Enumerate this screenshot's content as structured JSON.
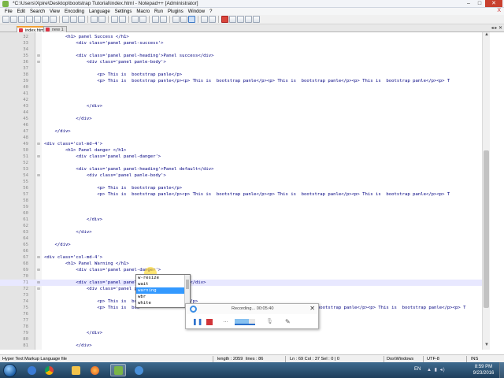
{
  "window": {
    "title": "*C:\\Users\\Xpire\\Desktop\\bootstrap Tutorial\\index.html - Notepad++ [Administrator]",
    "minimize": "–",
    "maximize": "□",
    "close": "✕"
  },
  "menu": [
    "File",
    "Edit",
    "Search",
    "View",
    "Encoding",
    "Language",
    "Settings",
    "Macro",
    "Run",
    "Plugins",
    "Window",
    "?"
  ],
  "menu_close": "X",
  "tabs": [
    {
      "label": "index.html"
    },
    {
      "label": "new 1"
    }
  ],
  "tab_arrows": "◂ ▸ ✕",
  "lines": [
    {
      "n": "32",
      "fold": "",
      "code": "        <h1> panel Success </h1>"
    },
    {
      "n": "33",
      "fold": "",
      "code": "            <div class='panel panel-success'>"
    },
    {
      "n": "34",
      "fold": "",
      "code": ""
    },
    {
      "n": "35",
      "fold": "⊟",
      "code": "            <div class='panel panel-heading'>Panel success</div>"
    },
    {
      "n": "36",
      "fold": "⊟",
      "code": "                <div class='panel panle-body'>"
    },
    {
      "n": "37",
      "fold": "",
      "code": ""
    },
    {
      "n": "38",
      "fold": "",
      "code": "                    <p> This is  bootstrap panle</p>"
    },
    {
      "n": "39",
      "fold": "",
      "code": "                    <p> This is  bootstrap panle</p><p> This is  bootstrap panle</p><p> This is  bootstrap panle</p><p> This is  bootstrap panle</p><p> T"
    },
    {
      "n": "40",
      "fold": "",
      "code": ""
    },
    {
      "n": "41",
      "fold": "",
      "code": ""
    },
    {
      "n": "42",
      "fold": "",
      "code": ""
    },
    {
      "n": "43",
      "fold": "",
      "code": "                </div>"
    },
    {
      "n": "44",
      "fold": "",
      "code": ""
    },
    {
      "n": "45",
      "fold": "",
      "code": "            </div>"
    },
    {
      "n": "46",
      "fold": "",
      "code": ""
    },
    {
      "n": "47",
      "fold": "",
      "code": "    </div>"
    },
    {
      "n": "48",
      "fold": "",
      "code": ""
    },
    {
      "n": "49",
      "fold": "⊟",
      "code": "<div class='col-md-4'>"
    },
    {
      "n": "50",
      "fold": "",
      "code": "        <h1> Panel danger </h1>"
    },
    {
      "n": "51",
      "fold": "⊟",
      "code": "            <div class='panel panel-danger'>"
    },
    {
      "n": "52",
      "fold": "",
      "code": ""
    },
    {
      "n": "53",
      "fold": "",
      "code": "            <div class='panel panel-heading'>Panel default</div>"
    },
    {
      "n": "54",
      "fold": "⊟",
      "code": "                <div class='panel panle-body'>"
    },
    {
      "n": "55",
      "fold": "",
      "code": ""
    },
    {
      "n": "56",
      "fold": "",
      "code": "                    <p> This is  bootstrap panle</p>"
    },
    {
      "n": "57",
      "fold": "",
      "code": "                    <p> This is  bootstrap panle</p><p> This is  bootstrap panle</p><p> This is  bootstrap panle</p><p> This is  bootstrap panle</p><p> T"
    },
    {
      "n": "58",
      "fold": "",
      "code": ""
    },
    {
      "n": "59",
      "fold": "",
      "code": ""
    },
    {
      "n": "60",
      "fold": "",
      "code": ""
    },
    {
      "n": "61",
      "fold": "",
      "code": "                </div>"
    },
    {
      "n": "62",
      "fold": "",
      "code": ""
    },
    {
      "n": "63",
      "fold": "",
      "code": "            </div>"
    },
    {
      "n": "64",
      "fold": "",
      "code": ""
    },
    {
      "n": "65",
      "fold": "",
      "code": "    </div>"
    },
    {
      "n": "66",
      "fold": "",
      "code": ""
    },
    {
      "n": "67",
      "fold": "⊟",
      "code": "<div class='col-md-4'>"
    },
    {
      "n": "68",
      "fold": "",
      "code": "        <h1> Panel Warning </h1>"
    },
    {
      "n": "69",
      "fold": "⊟",
      "code": "            <div class='panel panel-danger'>"
    },
    {
      "n": "70",
      "fold": "",
      "code": ""
    },
    {
      "n": "71",
      "fold": "⊟",
      "code": "            <div class='panel panel-warr'>Panel warning</div>"
    },
    {
      "n": "72",
      "fold": "⊟",
      "code": "                <div class='panel p"
    },
    {
      "n": "73",
      "fold": "",
      "code": ""
    },
    {
      "n": "74",
      "fold": "",
      "code": "                    <p> This is  boo                  </p>"
    },
    {
      "n": "75",
      "fold": "",
      "code": "                    <p> This is  boo                  </p><p> This is  bootstrap panle</p><p> This is  bootstrap panle</p><p> This is  bootstrap panle</p><p> T"
    },
    {
      "n": "76",
      "fold": "",
      "code": ""
    },
    {
      "n": "77",
      "fold": "",
      "code": ""
    },
    {
      "n": "78",
      "fold": "",
      "code": ""
    },
    {
      "n": "79",
      "fold": "",
      "code": "                </div>"
    },
    {
      "n": "80",
      "fold": "",
      "code": ""
    },
    {
      "n": "81",
      "fold": "",
      "code": "            </div>"
    },
    {
      "n": "82",
      "fold": "",
      "code": ""
    },
    {
      "n": "83",
      "fold": "",
      "code": "    </div>"
    },
    {
      "n": "84",
      "fold": "",
      "code": ""
    },
    {
      "n": "85",
      "fold": "",
      "code": ""
    }
  ],
  "current_line": "71",
  "autocomplete": {
    "items": [
      "w-resize",
      "wait",
      "warning",
      "wbr",
      "white"
    ],
    "selected": "warning"
  },
  "recorder": {
    "status": "Recording... 00:05:40",
    "close": "✕",
    "pause": "❚❚",
    "dots": "…",
    "mic": "🎙",
    "pen": "✎"
  },
  "status": {
    "file_type": "Hyper Text Markup Language file",
    "length": "length : 2059",
    "lines": "lines : 86",
    "position": "Ln : 69   Col : 37   Sel : 0 | 0",
    "eol": "Dos\\Windows",
    "encoding": "UTF-8",
    "mode": "INS"
  },
  "taskbar": {
    "language": "EN",
    "tray_icons": "▲ ▮ ◂)",
    "time": "8:59 PM",
    "date": "9/23/2016"
  },
  "colors": {
    "code_text": "#000080",
    "string": "#7d00c8",
    "selection": "#3399ff",
    "tab_accent": "#f1a033"
  }
}
